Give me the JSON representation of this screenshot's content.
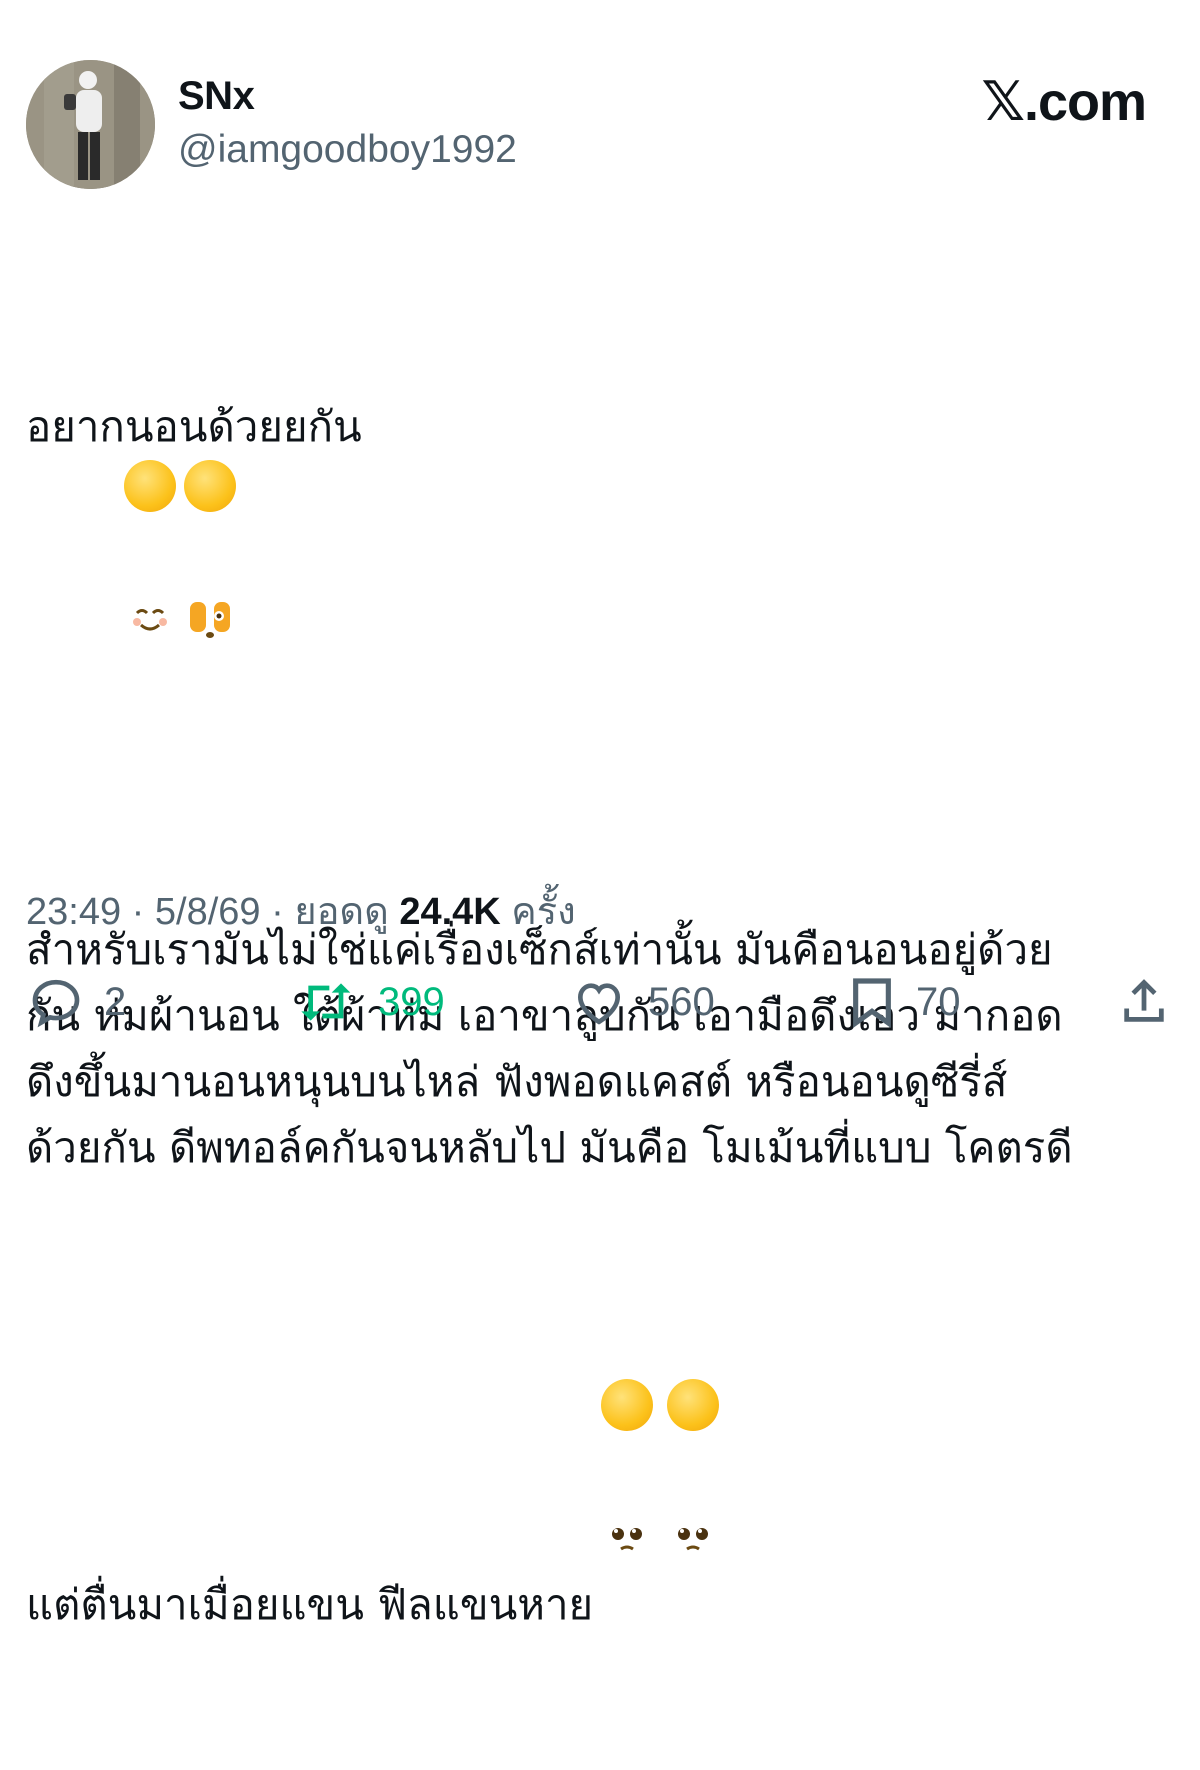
{
  "author": {
    "display_name": "SNx",
    "handle": "@iamgoodboy1992"
  },
  "brand": "𝕏.com",
  "tweet": {
    "paragraphs": [
      "อยากนอนด้วยยกัน",
      "สำหรับเรามันไม่ใช่แค่เรื่องเซ็กส์เท่านั้น มันคือนอนอยู่ด้วย\nกัน ห่มผ้านอน ใต้ผ้าห่ม เอาขาลูบกัน เอามือดึงเอว มากอด\nดึงขึ้นมานอนหนุนบนไหล่ ฟังพอดแคสต์ หรือนอนดูซีรี่ส์\nด้วยกัน ดีพทอล์คกันจนหลับไป มันคือ โมเม้นที่แบบ โคตรดี",
      "แต่ตื่นมาเมื่อยแขน ฟีลแขนหาย"
    ],
    "emojis": [
      "smiling-blush-emoji",
      "face-covering-eyes-emoji",
      "pleading-face-emoji",
      "pleading-face-emoji"
    ]
  },
  "meta": {
    "time": "23:49",
    "date": "5/8/69",
    "views_label": "ยอดดู",
    "views_count": "24.4K",
    "views_suffix": "ครั้ง",
    "separator": "·"
  },
  "actions": {
    "replies": "2",
    "retweets": "399",
    "likes": "560",
    "bookmarks": "70"
  },
  "colors": {
    "text": "#0f1419",
    "secondary": "#536471",
    "retweet_active": "#00ba7c",
    "background": "#ffffff"
  }
}
